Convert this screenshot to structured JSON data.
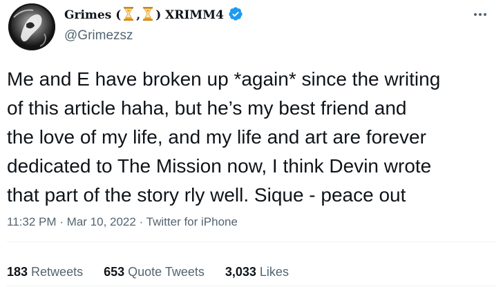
{
  "author": {
    "name_prefix": "Grimes (",
    "name_sep": ",",
    "name_suffix": ") XRIMM4",
    "handle": "@Grimezsz",
    "icons": [
      "hourglass-icon",
      "hourglass-icon",
      "verified-badge-icon",
      "more-icon"
    ]
  },
  "tweet": {
    "text": "Me and E have broken up *again* since the writing\nof this article haha, but he’s my best friend and\nthe love of my life, and my life and art are forever\ndedicated to The Mission now, I think Devin wrote\nthat part of the story rly well.   Sique - peace out"
  },
  "meta": {
    "time": "11:32 PM",
    "sep1": "·",
    "date": "Mar 10, 2022",
    "sep2": "·",
    "source": "Twitter for iPhone"
  },
  "stats": {
    "retweets_count": "183",
    "retweets_label": "Retweets",
    "quotes_count": "653",
    "quotes_label": "Quote Tweets",
    "likes_count": "3,033",
    "likes_label": "Likes"
  },
  "colors": {
    "text": "#0f1419",
    "secondary": "#536471",
    "verified": "#1d9bf0",
    "hourglass": "#f5a623",
    "divider": "#eff3f4"
  }
}
